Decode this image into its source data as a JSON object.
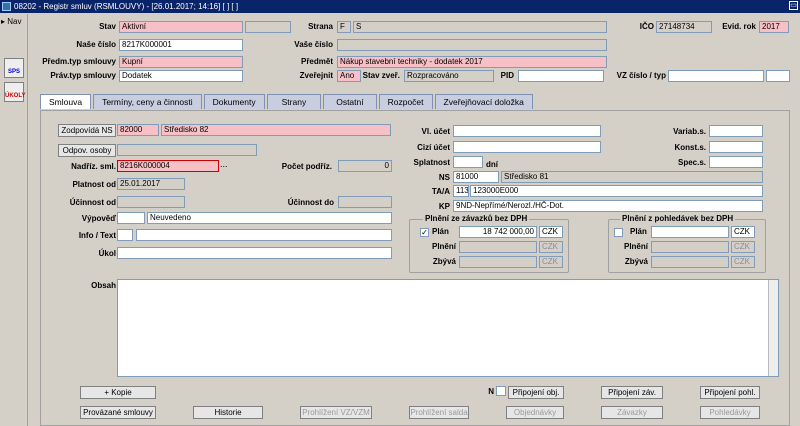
{
  "window": {
    "title": "08202 - Registr smluv (RSMLOUVY) - [26.01.2017; 14:16] [ ] [ ]"
  },
  "nav": {
    "tab": "Nav",
    "btn1": "SPS",
    "btn2": "ÚKOLY"
  },
  "header": {
    "stav_label": "Stav",
    "stav_value": "Aktivní",
    "strana_label": "Strana",
    "strana_code": "F",
    "strana_value": "S",
    "ico_label": "IČO",
    "ico_value": "27148734",
    "evid_label": "Evid. rok",
    "evid_value": "2017",
    "nase_cislo_label": "Naše číslo",
    "nase_cislo_value": "8217K000001",
    "vase_cislo_label": "Vaše číslo",
    "vase_cislo_value": "",
    "predm_typ_label": "Předm.typ smlouvy",
    "predm_typ_value": "Kupní",
    "predmet_label": "Předmět",
    "predmet_value": "Nákup stavební techniky - dodatek 2017",
    "prav_typ_label": "Práv.typ smlouvy",
    "prav_typ_value": "Dodatek",
    "zverejnit_label": "Zveřejnit",
    "zverejnit_value": "Ano",
    "stav_zver_label": "Stav zveř.",
    "stav_zver_value": "Rozpracováno",
    "pid_label": "PID",
    "pid_value": "",
    "vz_label": "VZ číslo / typ",
    "vz_value": ""
  },
  "tabs": [
    "Smlouva",
    "Termíny, ceny a činnosti",
    "Dokumenty",
    "Strany",
    "Ostatní",
    "Rozpočet",
    "Zveřejňovací doložka"
  ],
  "left": {
    "zodpovida_btn": "Zodpovídá NS",
    "zodpovida_code": "82000",
    "zodpovida_name": "Středisko 82",
    "odpov_btn": "Odpov. osoby",
    "nadriz_label": "Nadříz. sml.",
    "nadriz_value": "8216K000004",
    "nadriz_more": "...",
    "pocet_label": "Počet podříz.",
    "pocet_value": "0",
    "platnost_label": "Platnost od",
    "platnost_value": "25.01.2017",
    "ucinnost_od_label": "Účinnost od",
    "ucinnost_do_label": "Účinnost do",
    "vypoved_label": "Výpověď",
    "vypoved_value": "Neuvedeno",
    "info_label": "Info / Text",
    "ukol_label": "Úkol"
  },
  "right": {
    "vl_ucet_label": "Vl. účet",
    "cizi_ucet_label": "Cizí účet",
    "splatnost_label": "Splatnost",
    "dni_label": "dní",
    "variab_label": "Variab.s.",
    "konst_label": "Konst.s.",
    "spec_label": "Spec.s.",
    "ns_label": "NS",
    "ns_code": "81000",
    "ns_name": "Středisko 81",
    "taa_label": "TA/A",
    "taa_code": "113",
    "taa_value": "123000E000",
    "kp_label": "KP",
    "kp_value": "9ND-Nepřímé/Nerozl./HČ-Dot."
  },
  "plneni_zavazku": {
    "title": "Plnění ze závazků bez DPH",
    "check": "✓",
    "plan_label": "Plán",
    "plan_value": "18 742 000,00",
    "plan_cur": "CZK",
    "plneni_label": "Plnění",
    "plneni_cur": "CZK",
    "zbyva_label": "Zbývá",
    "zbyva_cur": "CZK"
  },
  "plneni_pohledavek": {
    "title": "Plnění z pohledávek bez DPH",
    "plan_label": "Plán",
    "plan_cur": "CZK",
    "plneni_label": "Plnění",
    "plneni_cur": "CZK",
    "zbyva_label": "Zbývá",
    "zbyva_cur": "CZK"
  },
  "obsah_label": "Obsah",
  "buttons": {
    "kopie": "+ Kopie",
    "n_label": "N",
    "pripojeni_obj": "Připojení obj.",
    "pripojeni_zav": "Připojení záv.",
    "pripojeni_pohl": "Připojení pohl.",
    "provazane": "Provázané smlouvy",
    "historie": "Historie",
    "prohlizeni_vz": "Prohlížení VZ/VZM",
    "prohlizeni_salda": "Prohlížení salda",
    "objednavky": "Objednávky",
    "zavazky": "Závazky",
    "pohledavky": "Pohledávky"
  }
}
